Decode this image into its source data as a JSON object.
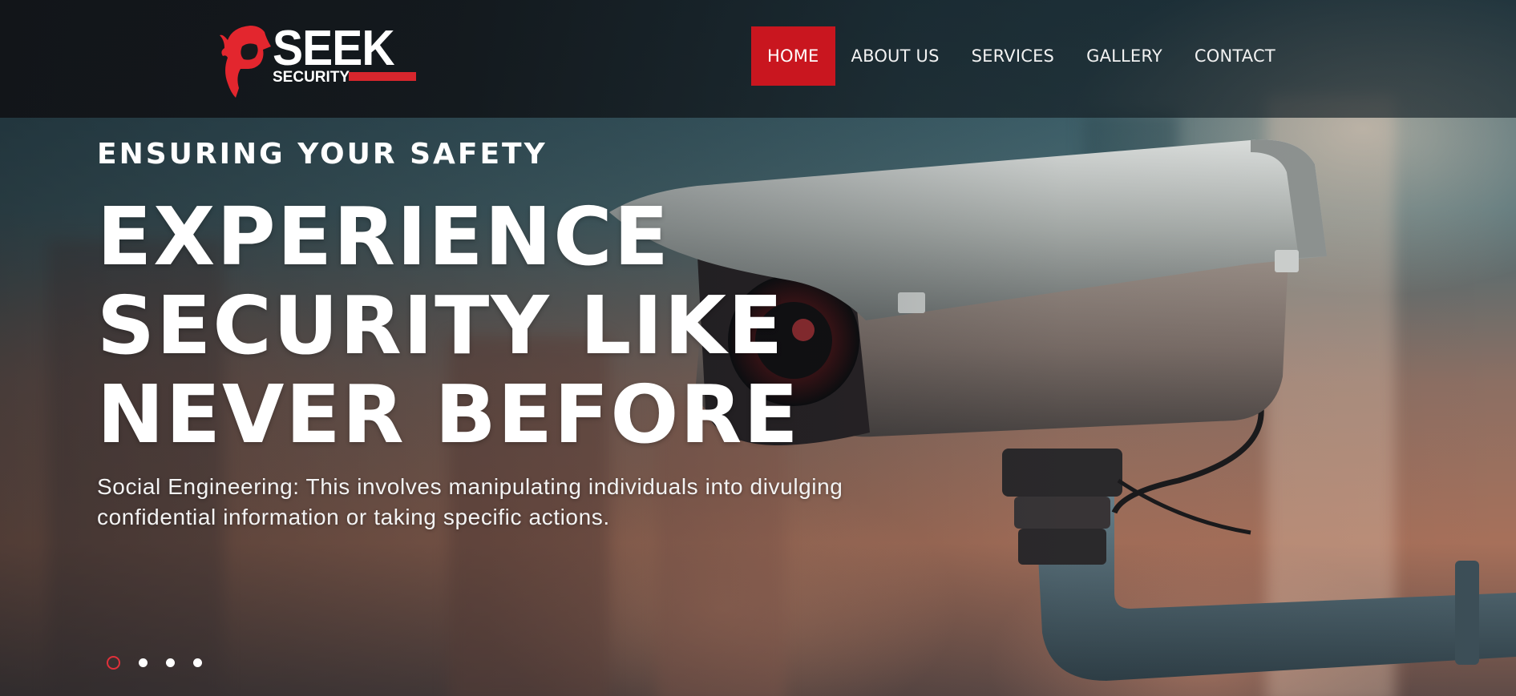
{
  "brand": {
    "name": "SEEK",
    "subtitle": "SECURITY",
    "accent_color": "#c9161f"
  },
  "nav": {
    "items": [
      {
        "label": "HOME",
        "active": true
      },
      {
        "label": "ABOUT US",
        "active": false
      },
      {
        "label": "SERVICES",
        "active": false
      },
      {
        "label": "GALLERY",
        "active": false
      },
      {
        "label": "CONTACT",
        "active": false
      }
    ]
  },
  "hero": {
    "tagline": "ENSURING YOUR SAFETY",
    "headline_lines": [
      "EXPERIENCE",
      "SECURITY LIKE",
      "NEVER BEFORE"
    ],
    "description": "Social Engineering: This involves manipulating individuals into divulging confidential information or taking specific actions.",
    "background_image": "security-camera-photo"
  },
  "slider": {
    "total_slides": 4,
    "active_index": 0,
    "active_dot_color": "#e0303a"
  }
}
